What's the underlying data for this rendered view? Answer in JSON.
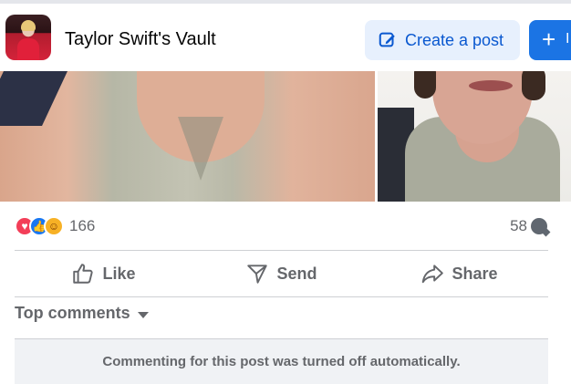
{
  "header": {
    "group_title": "Taylor Swift's Vault",
    "create_post_label": "Create a post",
    "plus_label": "+",
    "plus_trailing_letter": "I"
  },
  "reactions": {
    "icons": [
      "love",
      "like",
      "care"
    ],
    "count": "166"
  },
  "comments": {
    "count": "58"
  },
  "actions": {
    "like_label": "Like",
    "send_label": "Send",
    "share_label": "Share"
  },
  "top_comments": {
    "label": "Top comments"
  },
  "notice": {
    "text": "Commenting for this post was turned off automatically."
  },
  "colors": {
    "accent": "#1b74e4",
    "accent_light": "#e7f0fd",
    "secondary_text": "#65676b",
    "love": "#f33e58",
    "like": "#1877f2",
    "care": "#f7b125"
  }
}
